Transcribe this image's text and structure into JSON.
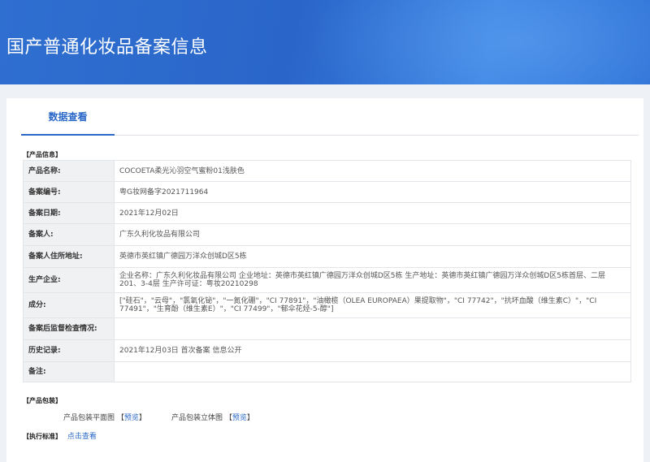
{
  "header": {
    "title": "国产普通化妆品备案信息"
  },
  "tabs": [
    {
      "label": "数据查看"
    }
  ],
  "product_info": {
    "section_label": "【产品信息】",
    "rows": [
      {
        "key": "产品名称:",
        "value": "COCOETA柔光沁羽空气蜜粉01浅肤色"
      },
      {
        "key": "备案编号:",
        "value": "粤G妆网备字2021711964"
      },
      {
        "key": "备案日期:",
        "value": "2021年12月02日"
      },
      {
        "key": "备案人:",
        "value": "广东久利化妆品有限公司"
      },
      {
        "key": "备案人住所地址:",
        "value": "英德市英红镇广德园万洋众创城D区5栋"
      },
      {
        "key": "生产企业:",
        "value": "企业名称：广东久利化妆品有限公司 企业地址：英德市英红镇广德园万洋众创城D区5栋 生产地址：英德市英红镇广德园万洋众创城D区5栋首层、二层201、3-4层 生产许可证：粤妆20210298"
      },
      {
        "key": "成分:",
        "value": "[\"硅石\"，\"云母\"，\"氯氧化铋\"，\"一氮化硼\"，\"CI 77891\"，\"油橄榄（OLEA EUROPAEA）果提取物\"，\"CI 77742\"，\"抗坏血酸（维生素C）\"，\"CI 77491\"，\"生育酚（维生素E）\"，\"CI 77499\"，\"郁伞花烃-5-醇\"]"
      },
      {
        "key": "备案后监督检查情况:",
        "value": ""
      },
      {
        "key": "历史记录:",
        "value": "2021年12月03日 首次备案 信息公开"
      },
      {
        "key": "备注:",
        "value": ""
      }
    ]
  },
  "packaging": {
    "section_label": "【产品包装】",
    "flat_label": "产品包装平面图",
    "stereo_label": "产品包装立体图",
    "bracket_open": "【",
    "bracket_close": "】",
    "preview_label": "预览"
  },
  "exec_standard": {
    "section_label": "【执行标准】",
    "link_label": "点击查看"
  },
  "colors": {
    "brand_blue": "#2a68c8",
    "banner_blue": "#2f6fd0",
    "label_bg": "#f0f1f3"
  }
}
